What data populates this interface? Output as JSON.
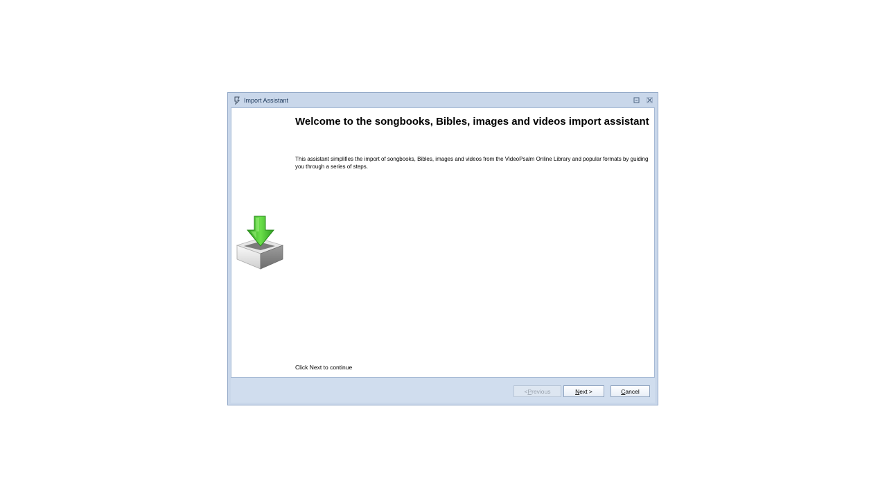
{
  "window": {
    "title": "Import Assistant"
  },
  "main": {
    "heading": "Welcome to the songbooks, Bibles, images and videos import assistant",
    "description": "This assistant simplifies the import of songbooks, Bibles, images and videos from the VideoPsalm Online Library and popular formats by guiding you through a series of steps.",
    "hint": "Click Next to continue"
  },
  "buttons": {
    "previous": {
      "prefix": "< ",
      "accel": "P",
      "rest": "revious",
      "enabled": false
    },
    "next": {
      "accel": "N",
      "rest": "ext >",
      "enabled": true
    },
    "cancel": {
      "accel": "C",
      "rest": "ancel",
      "enabled": true
    }
  },
  "icons": {
    "app": "videopsalm-app-icon",
    "hero": "import-tray-arrow-icon",
    "restore": "restore-window-icon",
    "close": "close-icon"
  },
  "colors": {
    "frame": "#c9d7ea",
    "footer": "#d0ddee",
    "arrow_green": "#4fc832",
    "title_text": "#1e395b"
  }
}
